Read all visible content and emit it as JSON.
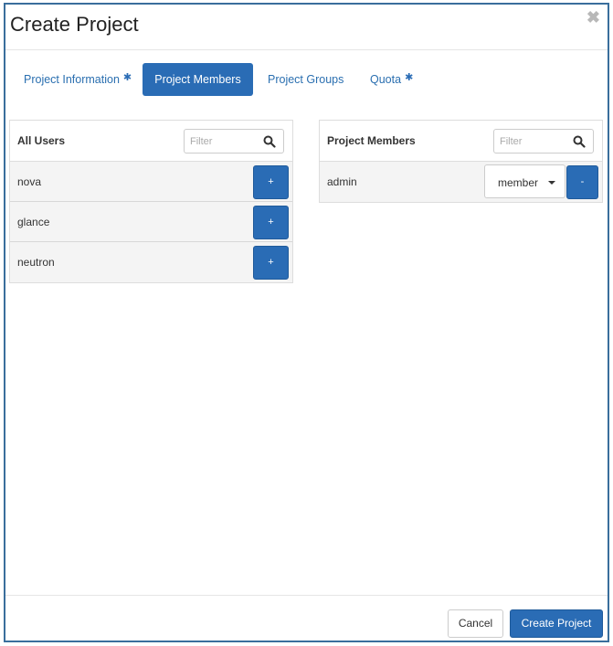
{
  "dialog": {
    "title": "Create Project",
    "close_glyph": "✖"
  },
  "tabs": [
    {
      "label": "Project Information",
      "required": true,
      "active": false
    },
    {
      "label": "Project Members",
      "required": false,
      "active": true
    },
    {
      "label": "Project Groups",
      "required": false,
      "active": false
    },
    {
      "label": "Quota",
      "required": true,
      "active": false
    }
  ],
  "required_marker": "✱",
  "all_users": {
    "title": "All Users",
    "filter_placeholder": "Filter",
    "add_label": "+",
    "items": [
      "nova",
      "glance",
      "neutron"
    ]
  },
  "project_members": {
    "title": "Project Members",
    "filter_placeholder": "Filter",
    "remove_label": "-",
    "items": [
      {
        "name": "admin",
        "role": "member"
      }
    ]
  },
  "footer": {
    "cancel_label": "Cancel",
    "create_label": "Create Project"
  },
  "colors": {
    "primary": "#2a6cb5",
    "border": "#3a6e9c"
  },
  "icons": {
    "close": "close-icon",
    "search": "search-icon",
    "required": "asterisk-icon",
    "dropdown": "caret-down-icon"
  }
}
